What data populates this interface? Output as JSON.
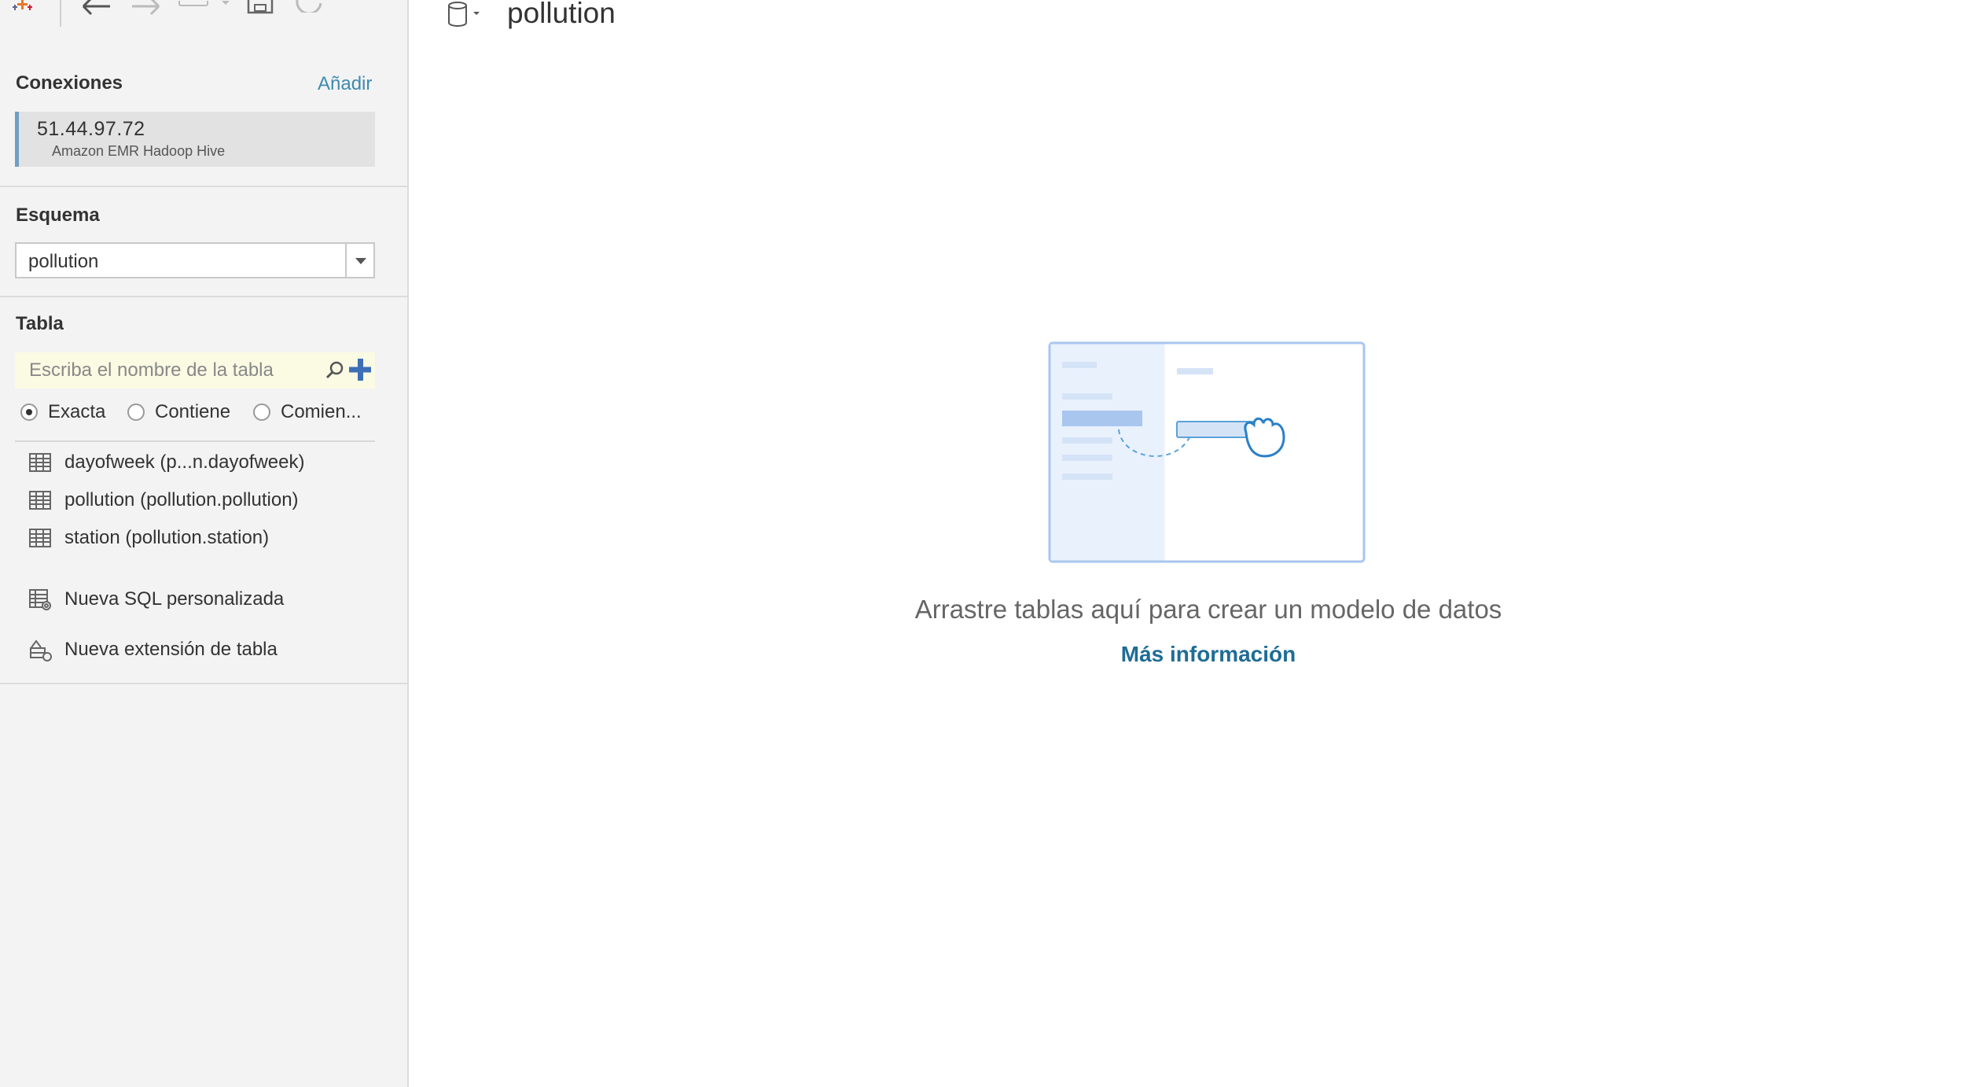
{
  "sidebar": {
    "connections": {
      "title": "Conexiones",
      "add_label": "Añadir",
      "items": [
        {
          "host": "51.44.97.72",
          "type": "Amazon EMR Hadoop Hive"
        }
      ]
    },
    "schema": {
      "title": "Esquema",
      "selected": "pollution"
    },
    "table": {
      "title": "Tabla",
      "search_placeholder": "Escriba el nombre de la tabla",
      "search_value": "",
      "match_options": [
        {
          "label": "Exacta",
          "selected": true
        },
        {
          "label": "Contiene",
          "selected": false
        },
        {
          "label": "Comien...",
          "selected": false
        }
      ],
      "tables": [
        {
          "label": "dayofweek (p...n.dayofweek)",
          "icon": "table-grid-icon"
        },
        {
          "label": "pollution (pollution.pollution)",
          "icon": "table-grid-icon"
        },
        {
          "label": "station (pollution.station)",
          "icon": "table-grid-icon"
        }
      ],
      "actions": [
        {
          "label": "Nueva SQL personalizada",
          "icon": "custom-sql-icon"
        },
        {
          "label": "Nueva extensión de tabla",
          "icon": "table-extension-icon"
        }
      ]
    }
  },
  "canvas": {
    "datasource_name": "pollution",
    "empty_message": "Arrastre tablas aquí para crear un modelo de datos",
    "learn_more": "Más información"
  },
  "colors": {
    "accent_link": "#3d8bb0",
    "learn_more": "#1f6c96",
    "connection_bar": "#6f9fc4",
    "search_bg": "#fbfbe4",
    "sidebar_bg": "#f3f3f3"
  }
}
